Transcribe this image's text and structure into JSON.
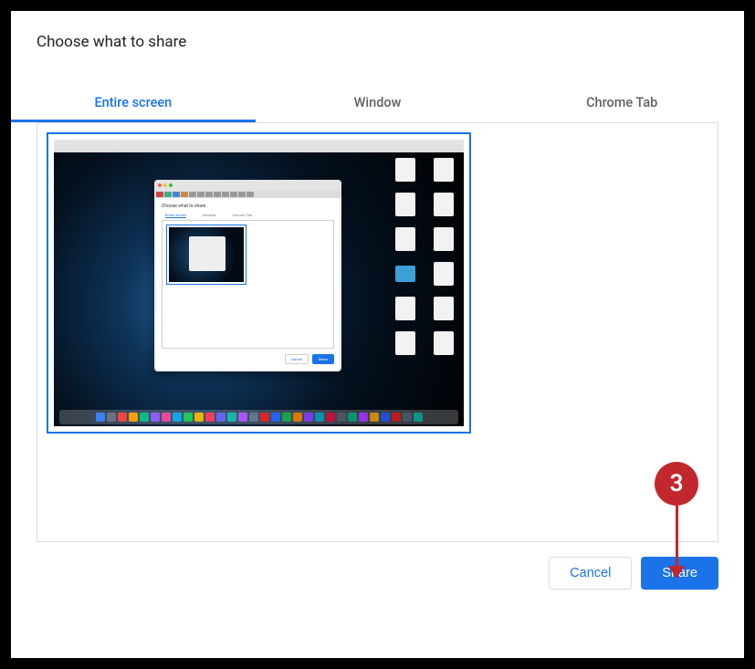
{
  "dialog": {
    "title": "Choose what to share",
    "tabs": [
      {
        "label": "Entire screen",
        "active": true
      },
      {
        "label": "Window",
        "active": false
      },
      {
        "label": "Chrome Tab",
        "active": false
      }
    ],
    "buttons": {
      "cancel": "Cancel",
      "share": "Share"
    }
  },
  "annotation": {
    "step_number": "3"
  },
  "preview": {
    "nested_dialog": {
      "title": "Choose what to share",
      "tabs": [
        "Entire screen",
        "Window",
        "Chrome Tab"
      ],
      "buttons": {
        "cancel": "Cancel",
        "share": "Share"
      }
    }
  }
}
